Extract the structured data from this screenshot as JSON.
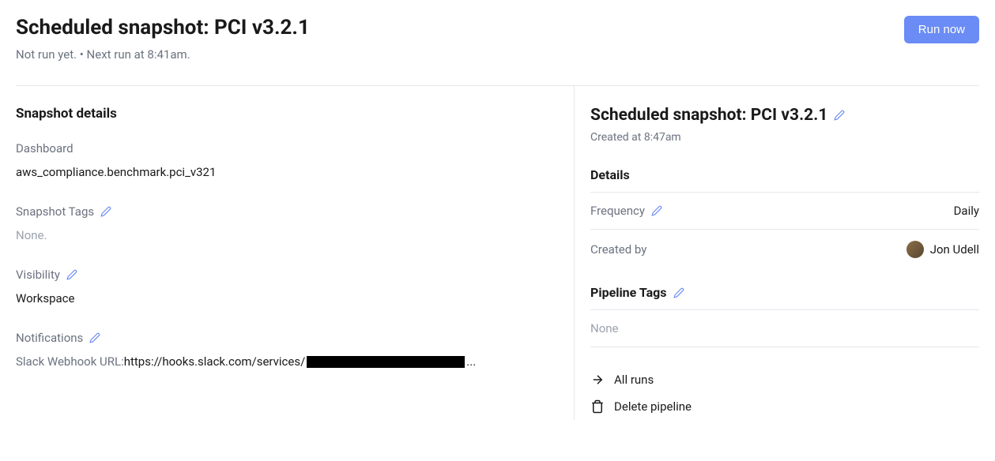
{
  "header": {
    "title": "Scheduled snapshot: PCI v3.2.1",
    "subtitle": "Not run yet.  •  Next run at 8:41am.",
    "run_button": "Run now"
  },
  "snapshot_details": {
    "heading": "Snapshot details",
    "dashboard_label": "Dashboard",
    "dashboard_value": "aws_compliance.benchmark.pci_v321",
    "tags_label": "Snapshot Tags",
    "tags_value": "None.",
    "visibility_label": "Visibility",
    "visibility_value": "Workspace",
    "notifications_label": "Notifications",
    "webhook_label": "Slack Webhook URL: ",
    "webhook_url_prefix": "https://hooks.slack.com/services/",
    "webhook_url_suffix": "..."
  },
  "pipeline": {
    "title": "Scheduled snapshot: PCI v3.2.1",
    "created_at": "Created at 8:47am",
    "details_heading": "Details",
    "frequency_label": "Frequency",
    "frequency_value": "Daily",
    "createdby_label": "Created by",
    "createdby_value": "Jon Udell",
    "tags_heading": "Pipeline Tags",
    "tags_value": "None",
    "all_runs": "All runs",
    "delete": "Delete pipeline"
  }
}
